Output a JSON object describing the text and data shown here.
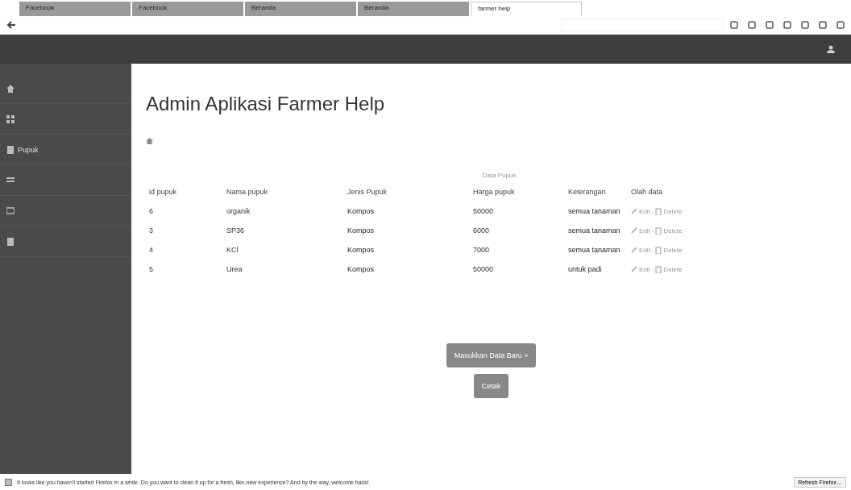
{
  "browser": {
    "tabs": [
      {
        "label": "Facebook",
        "selected": false
      },
      {
        "label": "Facebook",
        "selected": false
      },
      {
        "label": "Beranda",
        "selected": false
      },
      {
        "label": "Beranda",
        "selected": false
      },
      {
        "label": "farmer help",
        "selected": true
      }
    ]
  },
  "sidebar": {
    "items": [
      {
        "kind": "icon"
      },
      {
        "kind": "icon"
      },
      {
        "kind": "labeled",
        "label": "Pupuk"
      },
      {
        "kind": "icon"
      },
      {
        "kind": "icon"
      },
      {
        "kind": "icon"
      }
    ]
  },
  "page": {
    "title": "Admin Aplikasi Farmer Help"
  },
  "table": {
    "caption": "Data Pupuk",
    "columns": [
      "id pupuk",
      "Nama pupuk",
      "Jenis Pupuk",
      "Harga pupuk",
      "Keterangan",
      "Olah data"
    ],
    "rows": [
      {
        "cells": [
          "6",
          "organik",
          "Kompos",
          "50000",
          "semua tanaman"
        ],
        "edit": "Edit",
        "separator": "-",
        "delete": "Delete"
      },
      {
        "cells": [
          "3",
          "SP36",
          "Kompos",
          "6000",
          "semua tanaman"
        ],
        "edit": "Edit",
        "separator": "-",
        "delete": "Delete"
      },
      {
        "cells": [
          "4",
          "KCl",
          "Kompos",
          "7000",
          "semua tanaman"
        ],
        "edit": "Edit",
        "separator": "-",
        "delete": "Delete"
      },
      {
        "cells": [
          "5",
          "Urea",
          "Kompos",
          "50000",
          "untuk padi"
        ],
        "edit": "Edit",
        "separator": "-",
        "delete": "Delete"
      }
    ]
  },
  "buttons": [
    "Masukkan Data Baru »",
    "Cetak"
  ],
  "notification": {
    "message": "It looks like you haven't started Firefox in a while. Do you want to clean it up for a fresh, like-new experience? And by the way, welcome back!",
    "button": "Refresh Firefox…"
  }
}
